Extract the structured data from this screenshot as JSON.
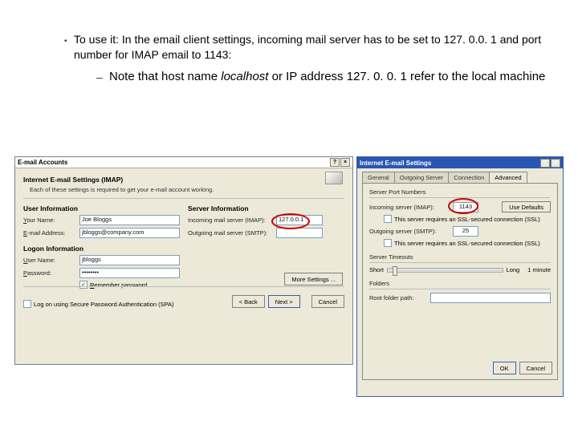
{
  "slide": {
    "bullet": "To use it: In the email client settings, incoming mail server has to be set to 127. 0.0. 1 and port number for IMAP email to 1143:",
    "sub_prefix": "Note that host name ",
    "sub_localhost": "localhost",
    "sub_mid": " or IP address 127. 0. 0. 1 refer to the local machine"
  },
  "dlg1": {
    "title": "E-mail Accounts",
    "heading": "Internet E-mail Settings (IMAP)",
    "desc": "Each of these settings is required to get your e-mail account working.",
    "user_info": "User Information",
    "server_info": "Server Information",
    "your_name_label": "Your Name:",
    "your_name_value": "Joe Bloggs",
    "email_label": "E-mail Address:",
    "email_value": "jbloggs@company.com",
    "incoming_label": "Incoming mail server (IMAP):",
    "incoming_value": "127.0.0.1",
    "outgoing_label": "Outgoing mail server (SMTP):",
    "outgoing_value": "",
    "logon_info": "Logon Information",
    "user_name_label": "User Name:",
    "user_name_value": "jbloggs",
    "password_label": "Password:",
    "password_value": "••••••••",
    "remember_pw": "Remember password",
    "spa": "Log on using Secure Password Authentication (SPA)",
    "more_settings": "More Settings ...",
    "back": "< Back",
    "next": "Next >",
    "cancel": "Cancel"
  },
  "dlg2": {
    "title": "Internet E-mail Settings",
    "tabs": {
      "general": "General",
      "outgoing": "Outgoing Server",
      "connection": "Connection",
      "advanced": "Advanced"
    },
    "ports_group": "Server Port Numbers",
    "incoming_label": "Incoming server (IMAP):",
    "incoming_value": "1143",
    "use_defaults": "Use Defaults",
    "ssl_in": "This server requires an SSL-secured connection (SSL)",
    "outgoing_label": "Outgoing server (SMTP):",
    "outgoing_value": "25",
    "ssl_out": "This server requires an SSL-secured connection (SSL)",
    "timeouts_group": "Server Timeouts",
    "short": "Short",
    "long": "Long",
    "duration": "1 minute",
    "folders_group": "Folders",
    "root_label": "Root folder path:",
    "root_value": "",
    "ok": "OK",
    "cancel": "Cancel"
  }
}
